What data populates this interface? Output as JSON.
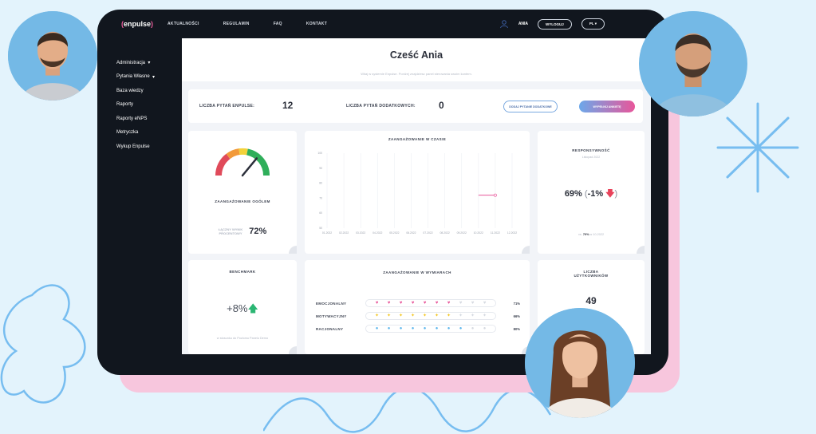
{
  "app": {
    "logo_text": "enpulse",
    "nav": [
      "AKTUALNOŚCI",
      "REGULAMIN",
      "FAQ",
      "KONTAKT"
    ],
    "user_name": "ANIA",
    "logout_label": "WYLOGUJ",
    "language": "PL"
  },
  "sidebar": {
    "items": [
      {
        "label": "Administracja"
      },
      {
        "label": "Pytania Własne"
      },
      {
        "label": "Baza wiedzy"
      },
      {
        "label": "Raporty"
      },
      {
        "label": "Raporty eNPS"
      },
      {
        "label": "Metryczka"
      },
      {
        "label": "Wykup Enpulse"
      }
    ]
  },
  "greeting": {
    "title": "Cześć Ania",
    "subtitle": "Witaj w systemie Enpulse. Poniżej znajdziesz panel sterowania swoim kontem."
  },
  "stats": {
    "enpulse_label": "LICZBA PYTAŃ ENPULSE:",
    "enpulse_value": "12",
    "extra_label": "LICZBA PYTAŃ DODATKOWYCH:",
    "extra_value": "0",
    "add_question_label": "DODAJ PYTANIE DODATKOWE",
    "fill_survey_label": "WYPEŁNIJ ANKIETĘ"
  },
  "engagement": {
    "title": "ZAANGAŻOWANIE OGÓLEM",
    "score_label_1": "ŁĄCZNY WYNIK",
    "score_label_2": "PROCENTOWY",
    "score_value": "72%",
    "gauge_value": 72
  },
  "engagement_time": {
    "title": "ZAANGAŻOWANIE W CZASIE"
  },
  "responsiveness": {
    "title": "RESPONSYWNOŚĆ",
    "subtitle": "Listopad 2022",
    "value": "69%",
    "change": "-1%",
    "footer_prefix": "vs.",
    "footer_value": "70%",
    "footer_suffix": "w 10.2022"
  },
  "benchmark": {
    "title": "BENCHMARK",
    "value": "+8%",
    "footer": "w stosunku do Poziomu Panelu Demo"
  },
  "dimensions": {
    "title": "ZAANGAŻOWANIE W WYMIARACH",
    "rows": [
      {
        "name": "EMOCJONALNY",
        "filled": 7,
        "total": 10,
        "pct": "71%",
        "color": "#e8569a",
        "glyph": "♥"
      },
      {
        "name": "MOTYWACYJNY",
        "filled": 7,
        "total": 10,
        "pct": "66%",
        "color": "#f3c623",
        "glyph": "✦"
      },
      {
        "name": "RACJONALNY",
        "filled": 8,
        "total": 10,
        "pct": "80%",
        "color": "#5bb5ec",
        "glyph": "●"
      }
    ]
  },
  "users": {
    "title_1": "LICZBA",
    "title_2": "UŻYTKOWNIKÓW",
    "value": "49"
  },
  "chart_data": {
    "type": "line",
    "title": "ZAANGAŻOWANIE W CZASIE",
    "x": [
      "01.2022",
      "02.2022",
      "03.2022",
      "04.2022",
      "05.2022",
      "06.2022",
      "07.2022",
      "08.2022",
      "09.2022",
      "10.2022",
      "11.2022",
      "12.2022"
    ],
    "yticks": [
      100,
      90,
      80,
      70,
      60,
      50
    ],
    "ylim": [
      50,
      100
    ],
    "series": [
      {
        "values": [
          null,
          null,
          null,
          null,
          null,
          null,
          null,
          null,
          null,
          72,
          72,
          null
        ],
        "color": "#e8569a"
      }
    ],
    "grid": true
  },
  "colors": {
    "accent_pink": "#e8569a",
    "accent_blue": "#6ca8ea",
    "dark_bg": "#11161e"
  }
}
